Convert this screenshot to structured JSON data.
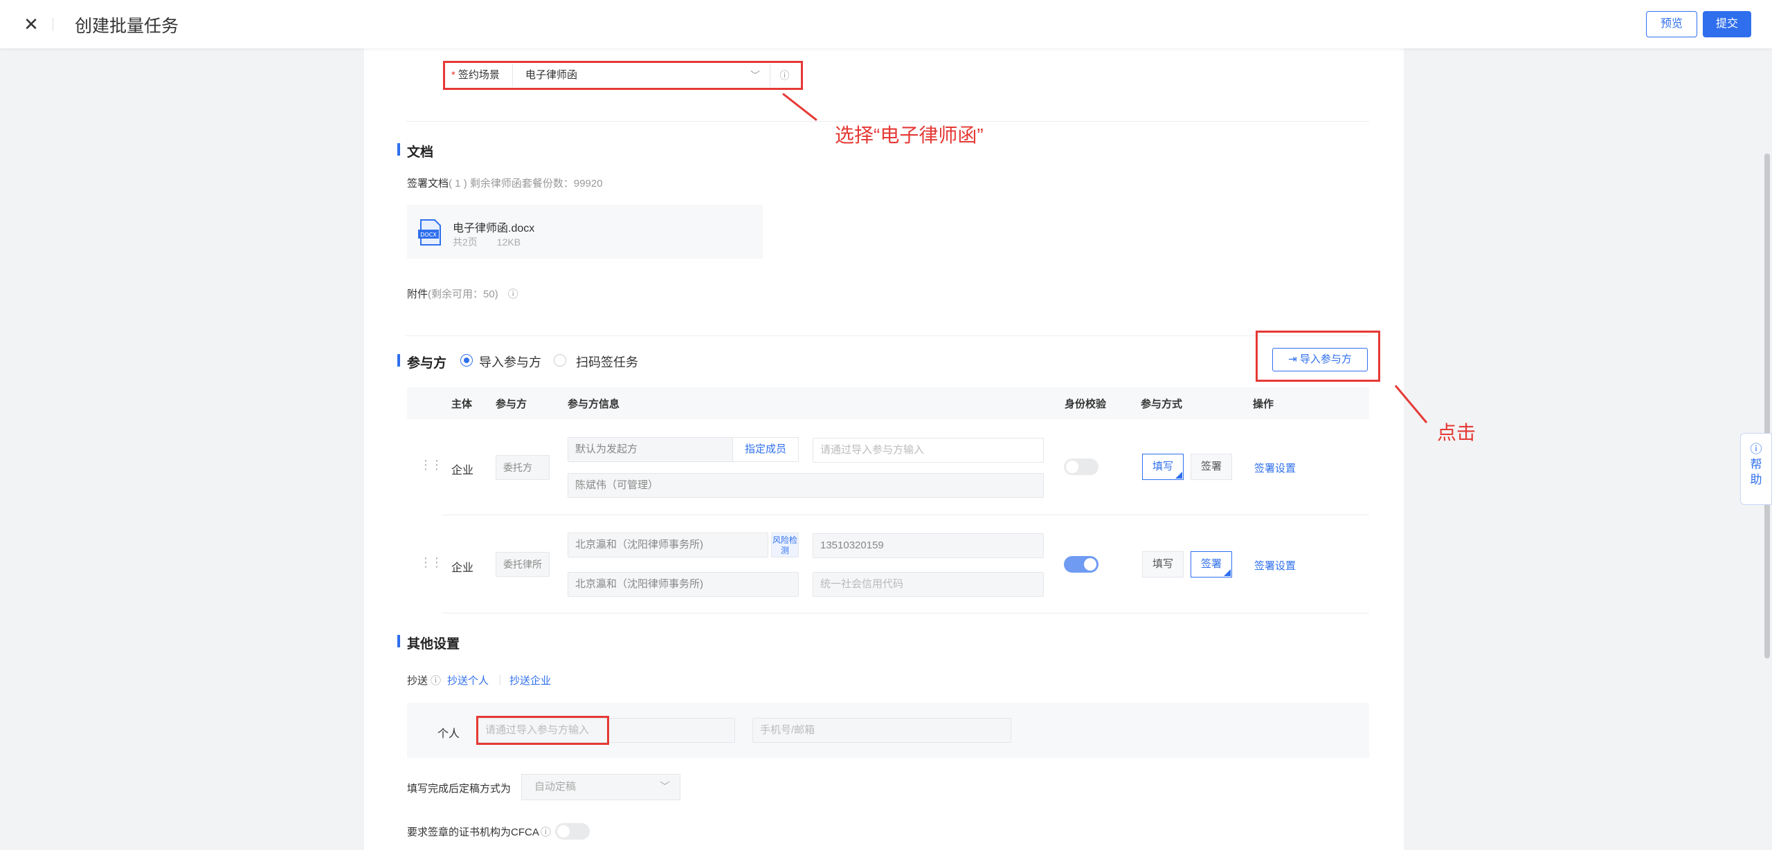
{
  "header": {
    "close_icon": "close-icon",
    "title": "创建批量任务",
    "preview_label": "预览",
    "submit_label": "提交"
  },
  "scene": {
    "label": "签约场景",
    "value": "电子律师函"
  },
  "annotations": {
    "select_hint": "选择“电子律师函”",
    "click_hint": "点击"
  },
  "documents": {
    "section_title": "文档",
    "sign_doc_label": "签署文档",
    "sign_doc_note": "( 1 ) 剩余律师函套餐份数：99920",
    "file_name": "电子律师函.docx",
    "file_pages": "共2页",
    "file_size": "12KB",
    "attachment_label": "附件",
    "attachment_note": "(剩余可用：50)"
  },
  "participants": {
    "section_title": "参与方",
    "radio_import": "导入参与方",
    "radio_scan": "扫码签任务",
    "import_button": "导入参与方",
    "columns": [
      "主体",
      "参与方",
      "参与方信息",
      "身份校验",
      "参与方式",
      "操作"
    ],
    "rows": [
      {
        "subject": "企业",
        "role": "委托方",
        "info_main": "默认为发起方",
        "assign_member": "指定成员",
        "info_right_placeholder": "请通过导入参与方输入",
        "info_sub": "陈斌伟（可管理）",
        "verify_on": false,
        "mode_fill": "填写",
        "mode_sign": "签署",
        "action": "签署设置"
      },
      {
        "subject": "企业",
        "role": "委托律所",
        "info_main": "北京瀛和（沈阳律师事务所)",
        "risk_check": "风险检测",
        "info_right": "13510320159",
        "info_sub": "北京瀛和（沈阳律师事务所)",
        "info_sub_right_placeholder": "统一社会信用代码",
        "verify_on": true,
        "mode_fill": "填写",
        "mode_sign": "签署",
        "action": "签署设置"
      }
    ]
  },
  "other": {
    "section_title": "其他设置",
    "cc_label": "抄送",
    "cc_personal": "抄送个人",
    "cc_company": "抄送企业",
    "person_label": "个人",
    "person_placeholder": "请通过导入参与方输入",
    "contact_placeholder": "手机号/邮箱",
    "finalize_label": "填写完成后定稿方式为",
    "finalize_value": "自动定稿",
    "cfca_label": "要求签章的证书机构为CFCA"
  },
  "help_tab": {
    "label": "帮助"
  },
  "colors": {
    "accent": "#2f6fed",
    "highlight": "#e53935"
  }
}
